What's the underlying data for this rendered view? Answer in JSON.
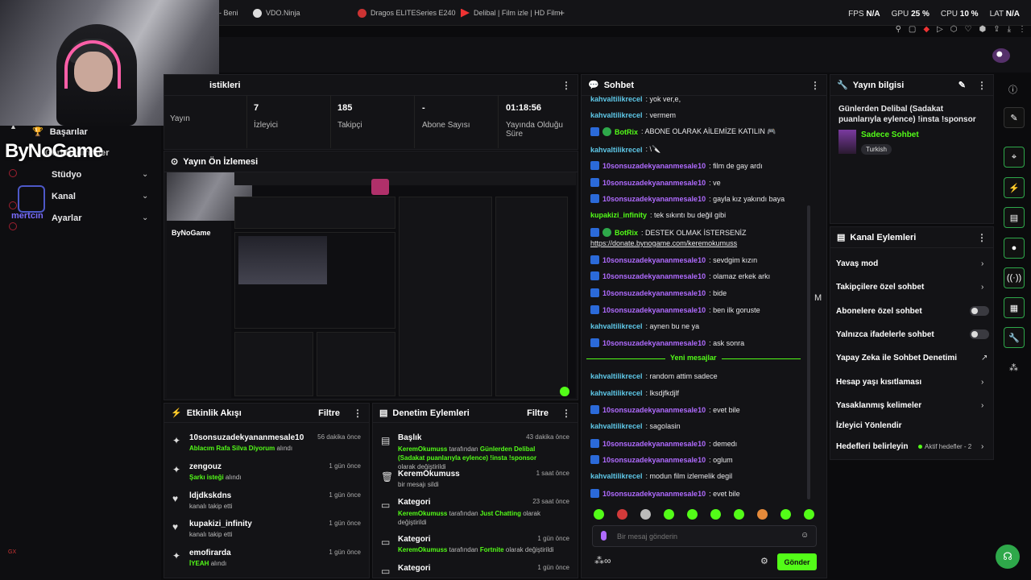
{
  "browser": {
    "tabs": [
      {
        "label": "- Beni"
      },
      {
        "label": "VDO.Ninja"
      },
      {
        "label": "Dragos ELITESeries E240"
      },
      {
        "label": "Delibal | Film izle | HD Film"
      }
    ],
    "new_tab": "+",
    "stats": {
      "fps_label": "FPS",
      "fps": "N/A",
      "gpu_label": "GPU",
      "gpu": "25 %",
      "cpu_label": "CPU",
      "cpu": "10 %",
      "lat_label": "LAT",
      "lat": "N/A"
    }
  },
  "sidebar": {
    "items": [
      {
        "label": "Başarılar"
      },
      {
        "label": "Stüdyo"
      },
      {
        "label": "Kanal"
      },
      {
        "label": "Ayarlar"
      }
    ],
    "overlay_label": "Geri Bildirimler",
    "logo_text": "ByNoGame",
    "logo2_text": "mertcin"
  },
  "stats_panel": {
    "title": "istikleri",
    "items": [
      {
        "value": "",
        "label": "Yayın"
      },
      {
        "value": "7",
        "label": "İzleyici"
      },
      {
        "value": "185",
        "label": "Takipçi"
      },
      {
        "value": "-",
        "label": "Abone Sayısı"
      },
      {
        "value": "01:18:56",
        "label": "Yayında Olduğu Süre"
      }
    ]
  },
  "preview_panel": {
    "title": "Yayın Ön İzlemesi",
    "overlay_logo": "ByNoGame"
  },
  "activity": {
    "title": "Etkinlik Akışı",
    "filter": "Filtre",
    "rows": [
      {
        "icon": "sparkle-icon",
        "title": "10sonsuzadekyananmesale10",
        "sub_highlight": "Ablacım Rafa Silva Diyorum",
        "sub": "alındı",
        "time": "56 dakika önce"
      },
      {
        "icon": "sparkle-icon",
        "title": "zengouz",
        "sub_highlight": "Şarkı isteği",
        "sub": "alındı",
        "time": "1 gün önce"
      },
      {
        "icon": "heart-icon",
        "title": "ldjdkskdns",
        "sub_highlight": "",
        "sub": "kanalı takip etti",
        "time": "1 gün önce"
      },
      {
        "icon": "heart-icon",
        "title": "kupakizi_infinity",
        "sub_highlight": "",
        "sub": "kanalı takip etti",
        "time": "1 gün önce"
      },
      {
        "icon": "sparkle-icon",
        "title": "emofirarda",
        "sub_highlight": "İYEAH",
        "sub": "alındı",
        "time": "1 gün önce"
      }
    ]
  },
  "moderation": {
    "title": "Denetim Eylemleri",
    "filter": "Filtre",
    "rows": [
      {
        "icon": "clipboard-icon",
        "title": "Başlık",
        "who": "KeremOkumuss",
        "mid": "tarafından",
        "value": "Günlerden Delibal (Sadakat puanlarıyla eylence) !insta !sponsor",
        "end": "olarak değiştirildi",
        "time": "43 dakika önce"
      },
      {
        "icon": "trash-icon",
        "title": "KeremOkumuss",
        "who": "",
        "mid": "",
        "value": "",
        "end": "bir mesajı sildi",
        "time": "1 saat önce"
      },
      {
        "icon": "monitor-icon",
        "title": "Kategori",
        "who": "KeremOkumuss",
        "mid": "tarafından",
        "value": "Just Chatting",
        "end": "olarak değiştirildi",
        "time": "23 saat önce"
      },
      {
        "icon": "monitor-icon",
        "title": "Kategori",
        "who": "KeremOkumuss",
        "mid": "tarafından",
        "value": "Fortnite",
        "end": "olarak değiştirildi",
        "time": "1 gün önce"
      },
      {
        "icon": "monitor-icon",
        "title": "Kategori",
        "who": "",
        "mid": "",
        "value": "",
        "end": "",
        "time": "1 gün önce"
      }
    ]
  },
  "chat": {
    "title": "Sohbet",
    "new_messages": "Yeni mesajlar",
    "input_placeholder": "Bir mesaj gönderin",
    "send_label": "Gönder",
    "side_letter": "M",
    "messages": [
      {
        "user": "kahvaltilikrecel",
        "style": "t",
        "badge": false,
        "text": ": yok ver,e,"
      },
      {
        "user": "kahvaltilikrecel",
        "style": "t",
        "badge": false,
        "text": ": vermem"
      },
      {
        "user": "BotRix",
        "style": "g",
        "badge": true,
        "text": ": ABONE OLARAK AİLEMİZE KATILIN 🎮"
      },
      {
        "user": "kahvaltilikrecel",
        "style": "t",
        "badge": false,
        "text": ": \\🔪"
      },
      {
        "user": "10sonsuzadekyananmesale10",
        "style": "p",
        "badge": true,
        "text": ": film de gay ardı"
      },
      {
        "user": "10sonsuzadekyananmesale10",
        "style": "p",
        "badge": true,
        "text": ": ve"
      },
      {
        "user": "10sonsuzadekyananmesale10",
        "style": "p",
        "badge": true,
        "text": ": gayla kız yakındı baya"
      },
      {
        "user": "kupakizi_infinity",
        "style": "g",
        "badge": false,
        "text": ": tek sıkıntı bu değil gibi"
      },
      {
        "user": "BotRix",
        "style": "g",
        "badge": true,
        "text": ": DESTEK OLMAK İSTERSENİZ"
      },
      {
        "user": "",
        "style": "t",
        "badge": false,
        "text": "https://donate.bynogame.com/keremokumuss"
      },
      {
        "user": "10sonsuzadekyananmesale10",
        "style": "p",
        "badge": true,
        "text": ": sevdgim kızın"
      },
      {
        "user": "10sonsuzadekyananmesale10",
        "style": "p",
        "badge": true,
        "text": ": olamaz erkek arkı"
      },
      {
        "user": "10sonsuzadekyananmesale10",
        "style": "p",
        "badge": true,
        "text": ": bide"
      },
      {
        "user": "10sonsuzadekyananmesale10",
        "style": "p",
        "badge": true,
        "text": ": ben ilk goruste"
      },
      {
        "user": "kahvaltilikrecel",
        "style": "t",
        "badge": false,
        "text": ": aynen bu ne ya"
      },
      {
        "user": "10sonsuzadekyananmesale10",
        "style": "p",
        "badge": true,
        "text": ": ask sonra"
      },
      {
        "user": "kahvaltilikrecel",
        "style": "t",
        "badge": false,
        "text": ": random attim sadece"
      },
      {
        "user": "kahvaltilikrecel",
        "style": "t",
        "badge": false,
        "text": ": lksdjfkdjlf"
      },
      {
        "user": "10sonsuzadekyananmesale10",
        "style": "p",
        "badge": true,
        "text": ": evet bile"
      },
      {
        "user": "kahvaltilikrecel",
        "style": "t",
        "badge": false,
        "text": ": sagolasin"
      },
      {
        "user": "10sonsuzadekyananmesale10",
        "style": "p",
        "badge": true,
        "text": ": demedı"
      },
      {
        "user": "10sonsuzadekyananmesale10",
        "style": "p",
        "badge": true,
        "text": ": oglum"
      },
      {
        "user": "kahvaltilikrecel",
        "style": "t",
        "badge": false,
        "text": ": modun film izlemelik degil"
      },
      {
        "user": "10sonsuzadekyananmesale10",
        "style": "p",
        "badge": true,
        "text": ": evet bile"
      }
    ]
  },
  "stream_info": {
    "title": "Yayın bilgisi",
    "stream_title": "Günlerden Delibal (Sadakat puanlarıyla eylence) !insta !sponsor",
    "category": "Sadece Sohbet",
    "tag": "Turkish"
  },
  "channel_actions": {
    "title": "Kanal Eylemleri",
    "items": [
      {
        "label": "Yavaş mod",
        "control": "chevron"
      },
      {
        "label": "Takipçilere özel sohbet",
        "control": "chevron"
      },
      {
        "label": "Abonelere özel sohbet",
        "control": "toggle"
      },
      {
        "label": "Yalnızca ifadelerle sohbet",
        "control": "toggle"
      },
      {
        "label": "Yapay Zeka ile Sohbet Denetimi",
        "control": "external"
      },
      {
        "label": "Hesap yaşı kısıtlaması",
        "control": "chevron"
      },
      {
        "label": "Yasaklanmış kelimeler",
        "control": "chevron"
      },
      {
        "label": "İzleyici Yönlendir",
        "control": "none"
      },
      {
        "label": "Hedefleri belirleyin",
        "control": "chevron"
      }
    ],
    "goals_status": "Aktif hedefler - 2"
  },
  "colors": {
    "accent": "#53fc18",
    "bg": "#0b0b0d",
    "panel": "#131316"
  },
  "corner_label": "GX"
}
